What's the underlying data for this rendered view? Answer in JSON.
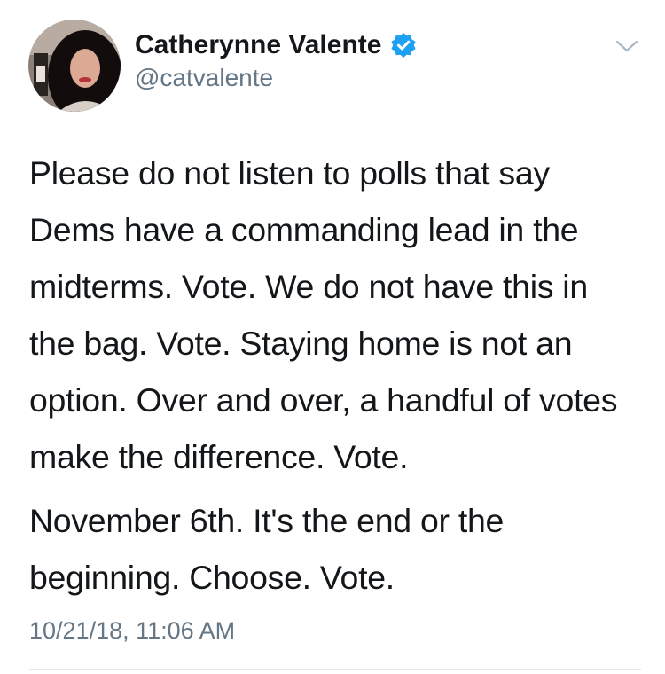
{
  "author": {
    "name": "Catherynne Valente",
    "handle": "@catvalente",
    "verified": true,
    "avatar_icon": "profile-photo"
  },
  "tweet": {
    "paragraphs": [
      "Please do not listen to polls that say Dems have a commanding lead in the midterms. Vote. We do not have this in the bag. Vote. Staying home is not an option. Over and over, a handful of votes make the difference. Vote.",
      "November 6th. It's the end or the beginning. Choose. Vote."
    ],
    "timestamp": "10/21/18, 11:06 AM"
  },
  "menu_icon": "chevron-down-icon",
  "colors": {
    "text": "#14171a",
    "secondary": "#657786",
    "verified_badge": "#1da1f2",
    "chevron": "#aab8c2",
    "divider": "#e1e8ed"
  }
}
